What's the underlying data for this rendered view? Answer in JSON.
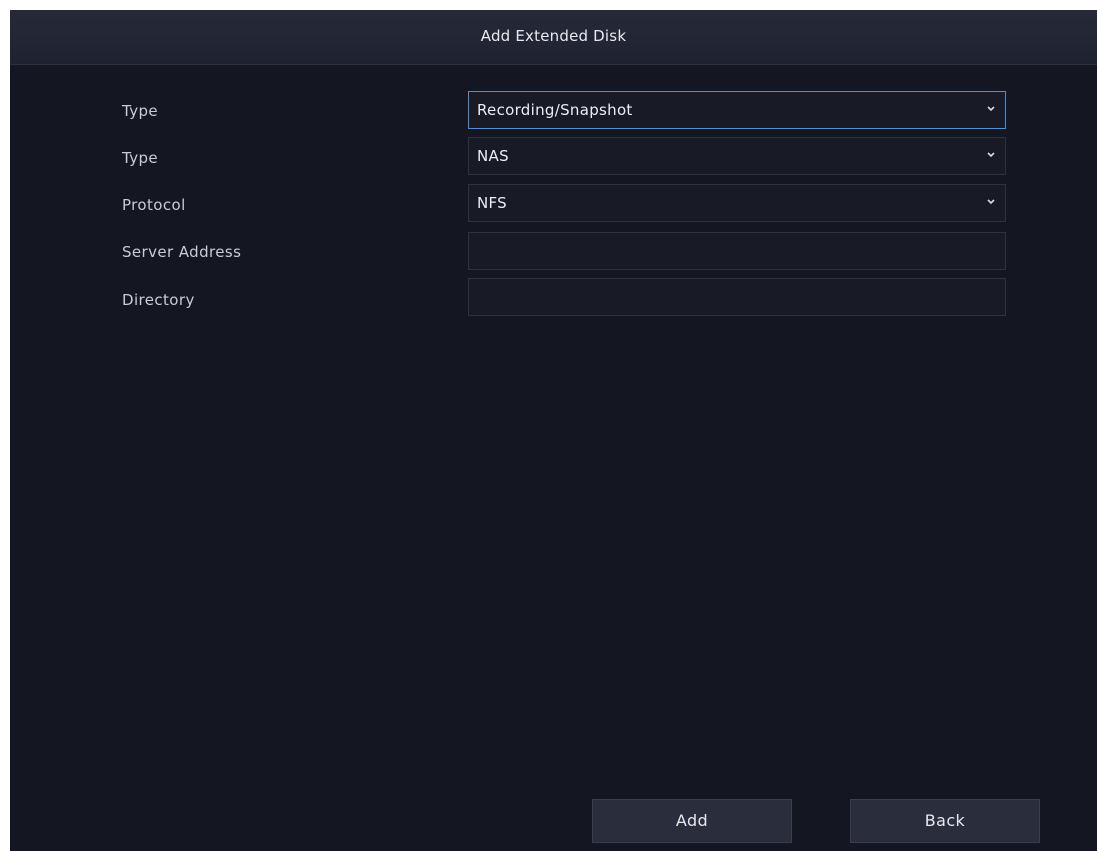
{
  "dialog": {
    "title": "Add Extended Disk"
  },
  "form": {
    "rows": [
      {
        "label": "Type",
        "value": "Recording/Snapshot",
        "kind": "select"
      },
      {
        "label": "Type",
        "value": "NAS",
        "kind": "select"
      },
      {
        "label": "Protocol",
        "value": "NFS",
        "kind": "select"
      },
      {
        "label": "Server Address",
        "value": "",
        "kind": "text"
      },
      {
        "label": "Directory",
        "value": "",
        "kind": "text"
      }
    ]
  },
  "buttons": {
    "add": "Add",
    "back": "Back"
  },
  "colors": {
    "background": "#141722",
    "titlebar": "#232634",
    "focus_border": "#4d8fd6",
    "button": "#2a2e3c"
  },
  "icons": {
    "select_arrow": "chevron-down-icon"
  }
}
